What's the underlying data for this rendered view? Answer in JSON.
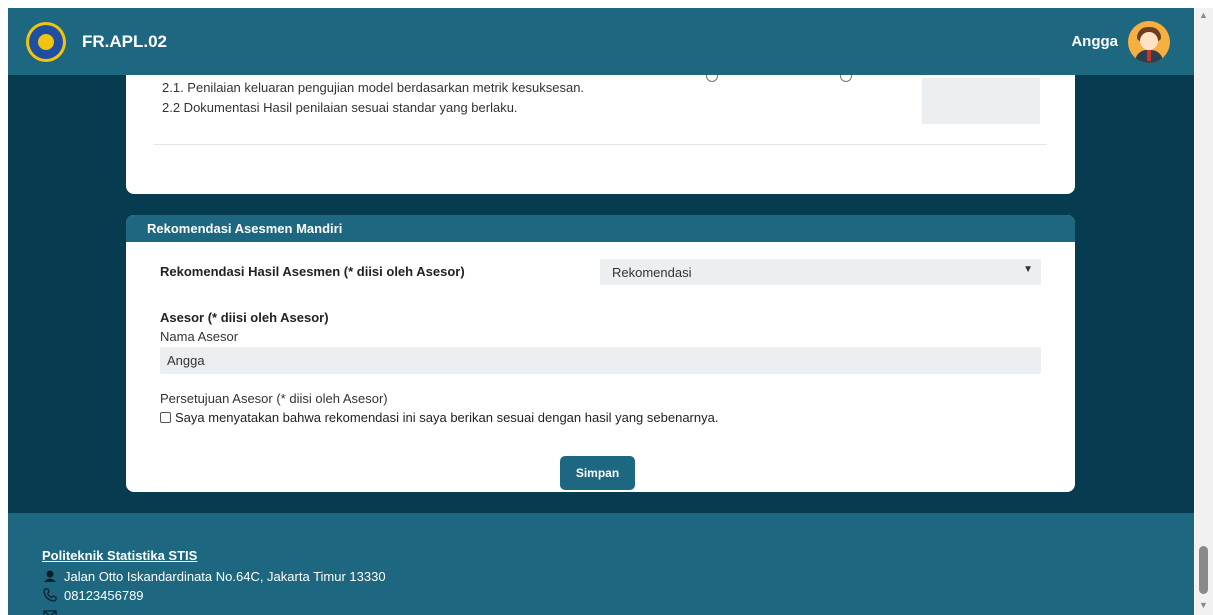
{
  "header": {
    "title": "FR.APL.02",
    "user_name": "Angga",
    "logo_icon": "stis-logo",
    "avatar_icon": "user-avatar"
  },
  "unit_card": {
    "lines": [
      "2.1. Penilaian keluaran pengujian model berdasarkan metrik kesuksesan.",
      "2.2 Dokumentasi Hasil penilaian sesuai standar yang berlaku."
    ]
  },
  "recommendation": {
    "header": "Rekomendasi Asesmen Mandiri",
    "result_label": "Rekomendasi Hasil Asesmen (* diisi oleh Asesor)",
    "result_select_value": "Rekomendasi",
    "asesor_heading": "Asesor (* diisi oleh Asesor)",
    "name_label": "Nama Asesor",
    "name_value": "Angga",
    "approval_label": "Persetujuan Asesor (* diisi oleh Asesor)",
    "consent_text": "Saya menyatakan bahwa rekomendasi ini saya berikan sesuai dengan hasil yang sebenarnya.",
    "save_label": "Simpan"
  },
  "footer": {
    "institution": "Politeknik Statistika STIS",
    "address": "Jalan Otto Iskandardinata No.64C, Jakarta Timur 13330",
    "phone": "08123456789"
  },
  "colors": {
    "primary": "#1d6880",
    "background": "#073b50",
    "field": "#eceff2"
  }
}
